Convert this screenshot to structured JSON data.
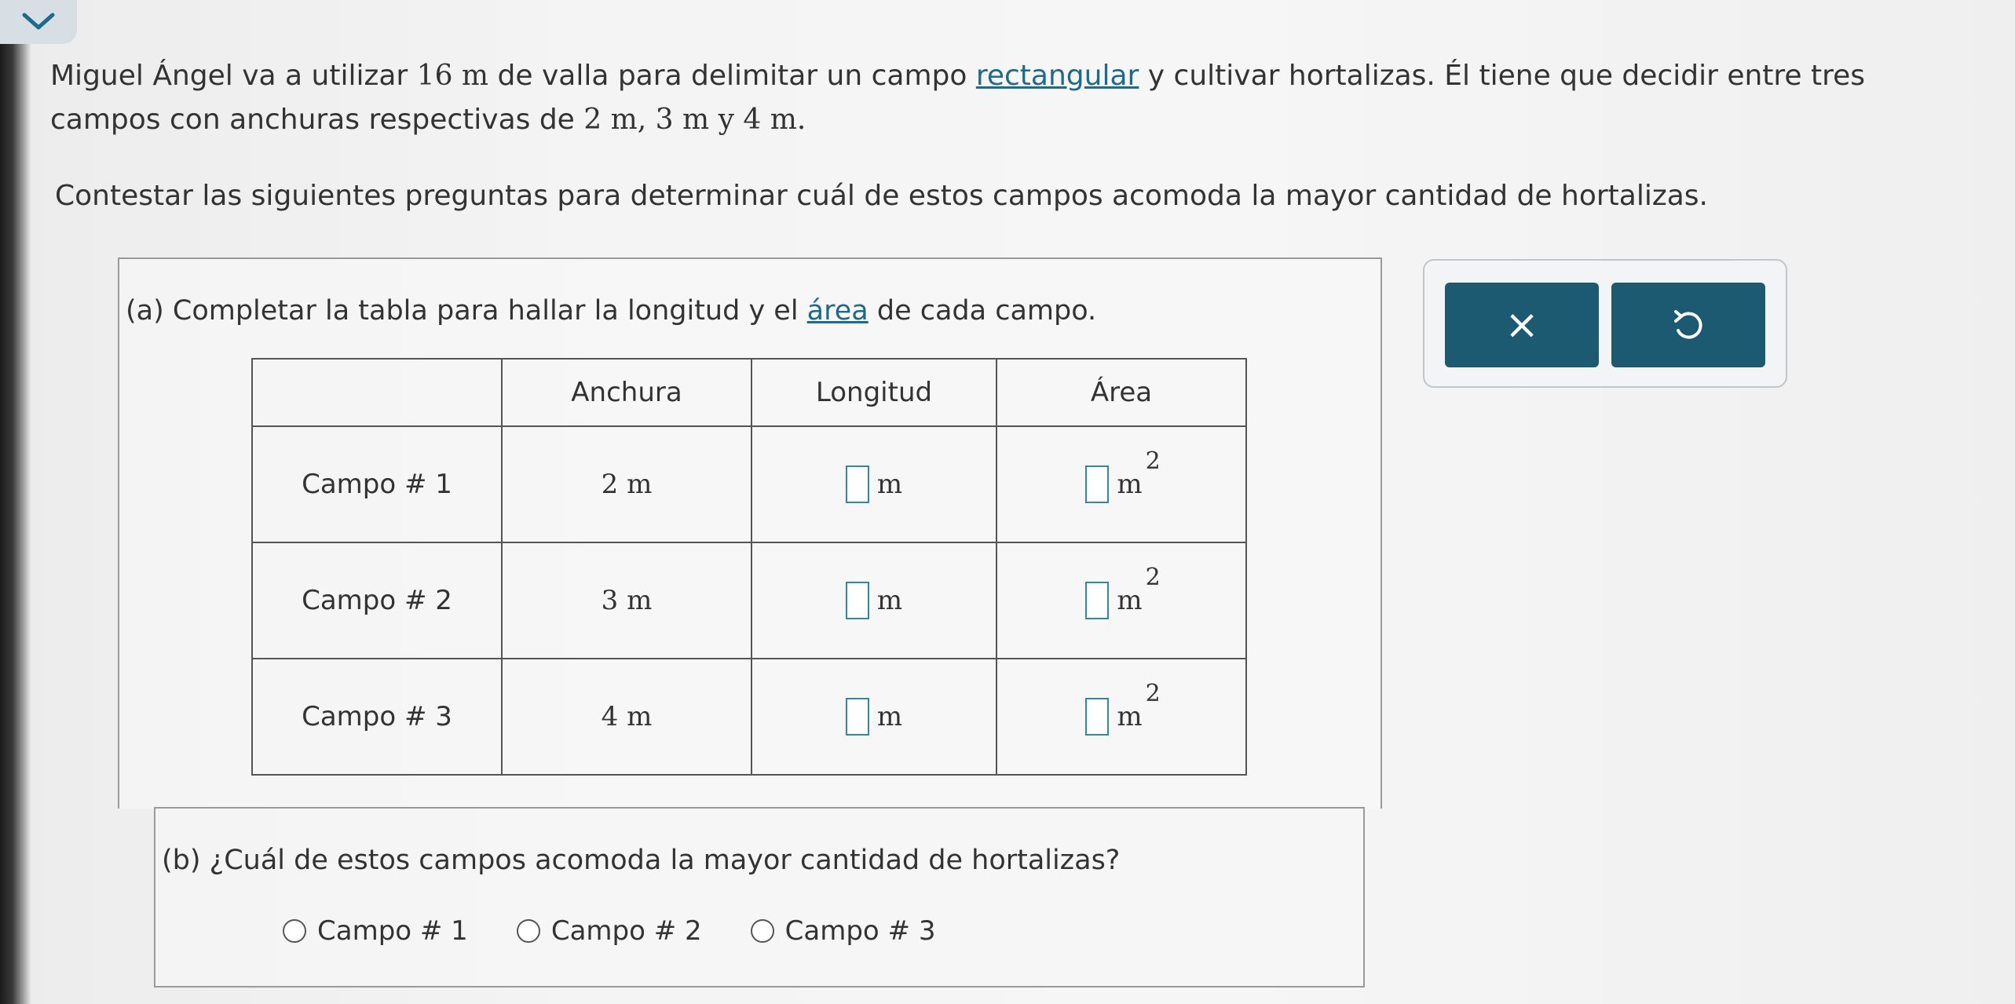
{
  "intro": {
    "line1_a": "Miguel Ángel va a utilizar ",
    "line1_num": "16 m",
    "line1_b": " de valla para delimitar un campo ",
    "line1_link": "rectangular",
    "line1_c": " y cultivar hortalizas. Él tiene que decidir entre tres",
    "line2_a": "campos con anchuras respectivas de ",
    "line2_math": "2 m, 3 m y 4 m",
    "line2_b": ".",
    "instruction": "Contestar las siguientes preguntas para determinar cuál de estos campos acomoda la mayor cantidad de hortalizas."
  },
  "part_a": {
    "prompt_a": "(a)  Completar la tabla para hallar la longitud y el ",
    "prompt_link": "área",
    "prompt_b": " de cada campo."
  },
  "table": {
    "headers": [
      "Anchura",
      "Longitud",
      "Área"
    ],
    "rows": [
      {
        "label": "Campo # 1",
        "width": "2 m",
        "length_unit": "m",
        "area_unit": "m",
        "area_exp": "2"
      },
      {
        "label": "Campo # 2",
        "width": "3 m",
        "length_unit": "m",
        "area_unit": "m",
        "area_exp": "2"
      },
      {
        "label": "Campo # 3",
        "width": "4 m",
        "length_unit": "m",
        "area_unit": "m",
        "area_exp": "2"
      }
    ]
  },
  "buttons": {
    "clear_symbol": "×",
    "undo_symbol": "↺"
  },
  "part_b": {
    "prompt": "(b)  ¿Cuál de estos campos acomoda la mayor cantidad de hortalizas?",
    "options": [
      "Campo # 1",
      "Campo # 2",
      "Campo # 3"
    ]
  },
  "icons": {
    "collapse": "chevron-down-icon",
    "clear": "close-icon",
    "undo": "undo-icon",
    "radio": "radio-circle-icon"
  },
  "colors": {
    "accent": "#1c5a72",
    "link": "#1d6b8a",
    "input_border": "#2b8aa5"
  }
}
